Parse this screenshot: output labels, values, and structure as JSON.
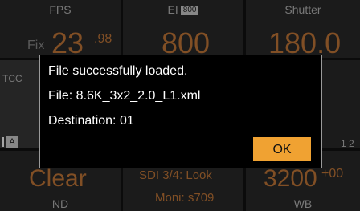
{
  "tiles": {
    "fps": {
      "label": "FPS",
      "mode": "Fix",
      "value": "23",
      "fraction": ".98"
    },
    "ei": {
      "label": "EI",
      "badge": "800",
      "value": "800"
    },
    "shutter": {
      "label": "Shutter",
      "value": "180.0"
    },
    "left_mid": {
      "partial": "TCC"
    },
    "left_icon": {
      "partial": "A"
    },
    "right_mid": {
      "partial": "1 2"
    },
    "nd": {
      "value": "Clear",
      "label": "ND"
    },
    "sdi": {
      "line1": "SDI 3/4: Look",
      "line2": "Moni: s709"
    },
    "wb": {
      "value": "3200",
      "offset": "+00",
      "label": "WB"
    }
  },
  "dialog": {
    "message": "File successfully loaded.",
    "file": "File: 8.6K_3x2_2.0_L1.xml",
    "destination": "Destination: 01",
    "ok_label": "OK"
  },
  "colors": {
    "accent": "#f0a232",
    "value_orange": "#c77a3a",
    "tile_bg": "#2a2a2a",
    "dialog_bg": "#000000"
  }
}
